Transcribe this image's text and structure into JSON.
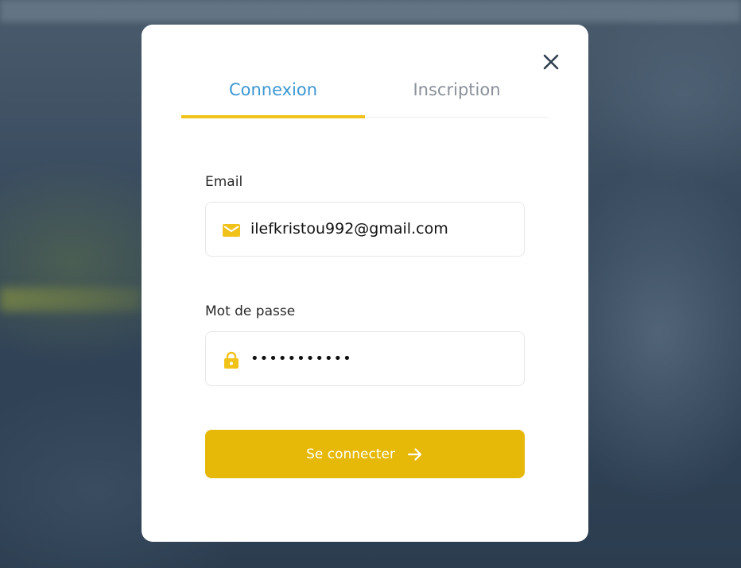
{
  "auth_modal": {
    "tabs": [
      {
        "label": "Connexion",
        "active": true
      },
      {
        "label": "Inscription",
        "active": false
      }
    ],
    "email": {
      "label": "Email",
      "value": "ilefkristou992@gmail.com",
      "icon": "mail-icon"
    },
    "password": {
      "label": "Mot de passe",
      "value": "•••••••••••",
      "icon": "lock-icon"
    },
    "submit": {
      "label": "Se connecter",
      "icon": "arrow-right-icon"
    },
    "close_icon": "close-icon"
  },
  "colors": {
    "accent_yellow": "#e6b807",
    "tab_active": "#3b97d3",
    "tab_inactive": "#8a9098",
    "underline": "#f0c21a"
  }
}
